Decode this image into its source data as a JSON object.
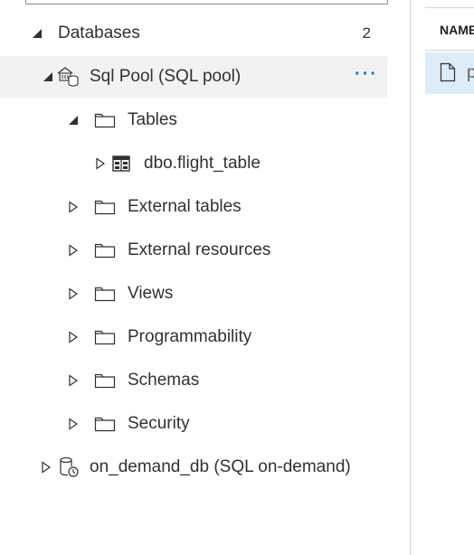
{
  "tree": {
    "databases": {
      "label": "Databases",
      "count": "2"
    },
    "sql_pool": {
      "label": "Sql Pool (SQL pool)",
      "more": "···"
    },
    "tables": {
      "label": "Tables"
    },
    "flight_table": {
      "label": "dbo.flight_table"
    },
    "external_tables": {
      "label": "External tables"
    },
    "external_resources": {
      "label": "External resources"
    },
    "views": {
      "label": "Views"
    },
    "programmability": {
      "label": "Programmability"
    },
    "schemas": {
      "label": "Schemas"
    },
    "security": {
      "label": "Security"
    },
    "on_demand": {
      "label": "on_demand_db (SQL on-demand)"
    }
  },
  "file_list": {
    "header": "NAME",
    "first_item": "p"
  },
  "colors": {
    "accent": "#0078d4",
    "selected_row": "#f3f2f1",
    "selected_file": "#deecf9"
  }
}
